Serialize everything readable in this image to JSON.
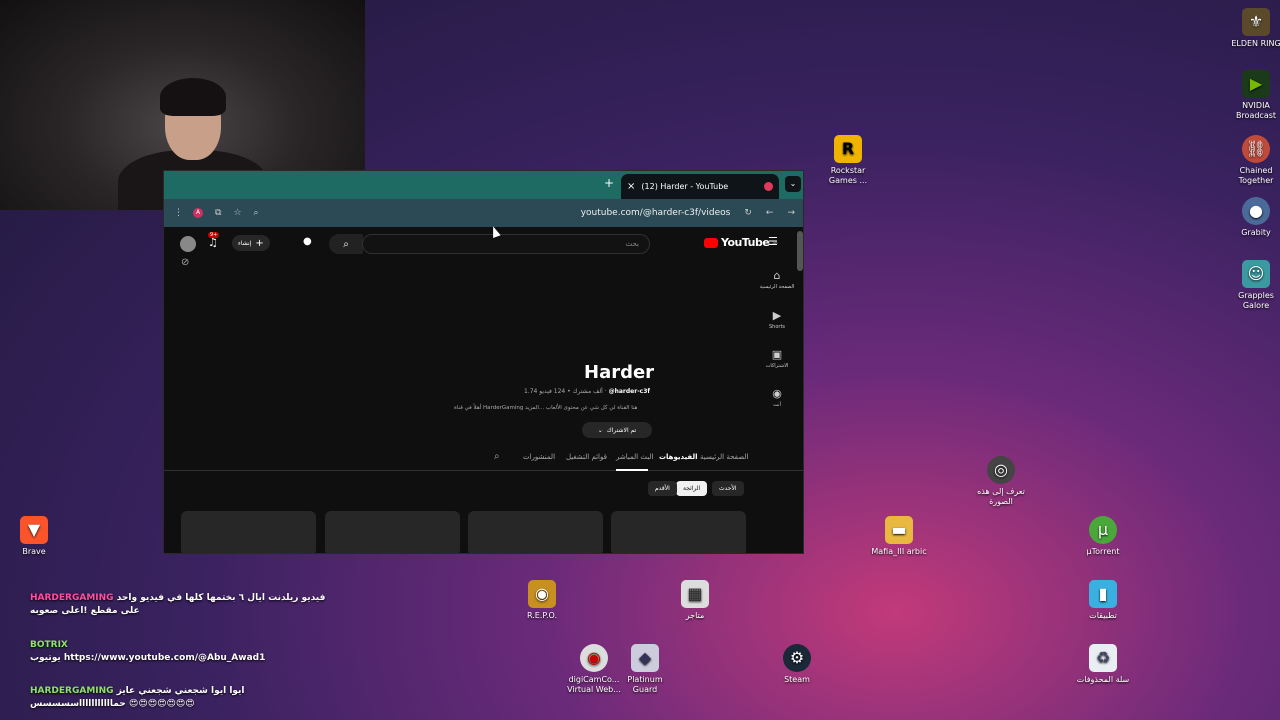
{
  "window": {
    "tab_title": "(12) Harder - YouTube",
    "new_tab": "+",
    "tab_close": "×",
    "url": "youtube.com/@harder-c3f/videos"
  },
  "youtube": {
    "logo_text": "YouTube",
    "logo_region": "SA",
    "search_placeholder": "بحث",
    "create_label": "إنشاء",
    "notif_count": "9+",
    "rail": [
      "الصفحة الرئيسية",
      "Shorts",
      "الاشتراكات",
      "أنت"
    ],
    "channel": {
      "name": "Harder",
      "handle": "@harder-c3f",
      "stats": "1.74 ألف مشترك • 124 فيديو",
      "description": "أهلاً في قناة HarderGaming هنا القناة لي كل شي عن محتوى الألعاب ...المزيد",
      "subscribed_label": "تم الاشتراك"
    },
    "tabs": [
      "الصفحة الرئيسية",
      "الفيديوهات",
      "البث المباشر",
      "قوائم التشغيل",
      "المنشورات"
    ],
    "chips": [
      "الأحدث",
      "الرائجة",
      "الأقدم"
    ]
  },
  "desktop": {
    "icons_right": [
      "ELDEN RING",
      "NVIDIA Broadcast",
      "Chained Together",
      "Grabity",
      "Grapples Galore"
    ],
    "rockstar": "Rockstar Games ...",
    "lens": "تعرف إلى هذه الصورة",
    "mafia": "Mafia_III arbic",
    "utorrent": "µTorrent",
    "brave": "Brave",
    "repo": "R.E.P.O.",
    "store": "متاجر",
    "apps": "تطبيقات",
    "digicam": "digiCamCo... Virtual Web...",
    "platinum": "Platinum Guard",
    "steam": "Steam",
    "recycle": "سلة المحذوفات"
  },
  "chat": [
    {
      "user": "HARDERGAMING",
      "text": "فيديو ريلدنت ايال ٦ بختمها كلها في فيديو واحد على مقطع !اعلى صعوبه"
    },
    {
      "user": "BOTRIX",
      "text": "يوتيوب https://www.youtube.com/@Abu_Awad1"
    },
    {
      "user": "HARDERGAMING",
      "text": "ايوا ايوا شجعني شجعني عايز حماااااااااااسسسسس 😍😍😍😍😍😍😍"
    }
  ]
}
